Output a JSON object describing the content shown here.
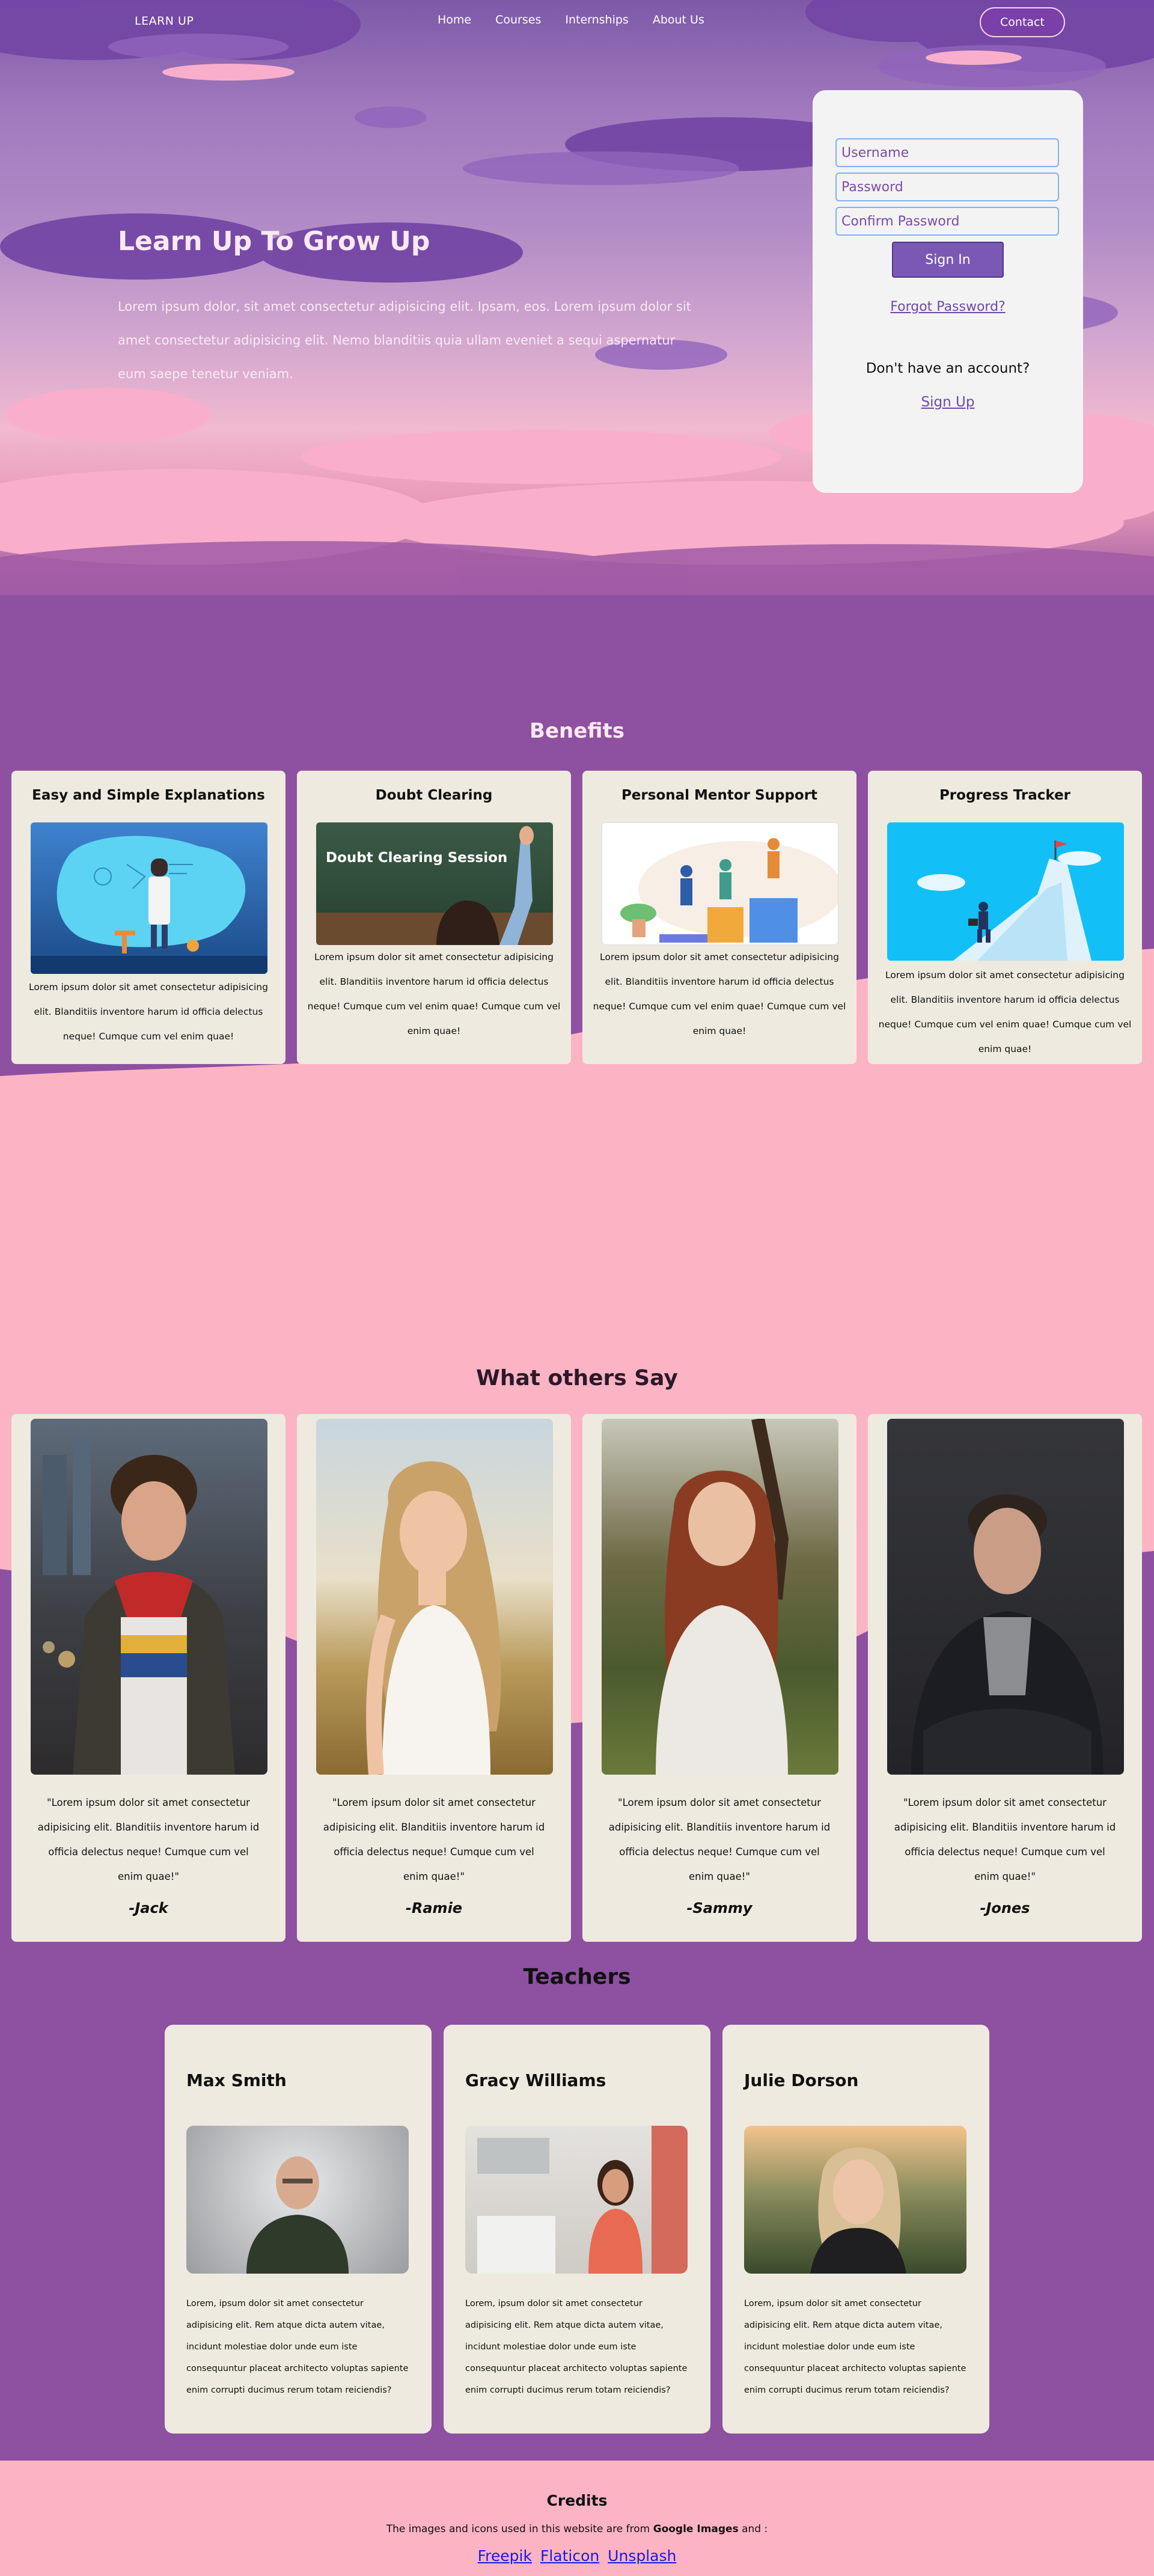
{
  "nav": {
    "brand": "LEARN UP",
    "links": [
      "Home",
      "Courses",
      "Internships",
      "About Us"
    ],
    "contact": "Contact"
  },
  "hero": {
    "title": "Learn Up To Grow Up",
    "text": "Lorem ipsum dolor, sit amet consectetur adipisicing elit. Ipsam, eos. Lorem ipsum dolor sit amet consectetur adipisicing elit. Nemo blanditiis quia ullam eveniet a sequi aspernatur eum saepe tenetur veniam."
  },
  "signin": {
    "username_placeholder": "Username",
    "password_placeholder": "Password",
    "confirm_placeholder": "Confirm Password",
    "button": "Sign In",
    "forgot": "Forgot Password?",
    "no_account": "Don't have an account?",
    "signup": "Sign Up"
  },
  "benefits": {
    "title": "Benefits",
    "cards": [
      {
        "title": "Easy and Simple Explanations",
        "text": "Lorem ipsum dolor sit amet consectetur adipisicing elit. Blanditiis inventore harum id officia delectus neque! Cumque cum vel enim quae!"
      },
      {
        "title": "Doubt Clearing",
        "image_caption": "Doubt Clearing Session",
        "text": "Lorem ipsum dolor sit amet consectetur adipisicing elit. Blanditiis inventore harum id officia delectus neque! Cumque cum vel enim quae! Cumque cum vel enim quae!"
      },
      {
        "title": "Personal Mentor Support",
        "text": "Lorem ipsum dolor sit amet consectetur adipisicing elit. Blanditiis inventore harum id officia delectus neque! Cumque cum vel enim quae! Cumque cum vel enim quae!"
      },
      {
        "title": "Progress Tracker",
        "text": "Lorem ipsum dolor sit amet consectetur adipisicing elit. Blanditiis inventore harum id officia delectus neque! Cumque cum vel enim quae! Cumque cum vel enim quae!"
      }
    ]
  },
  "testimonials": {
    "title": "What others Say",
    "items": [
      {
        "quote": "\"Lorem ipsum dolor sit amet consectetur adipisicing elit. Blanditiis inventore harum id officia delectus neque! Cumque cum vel enim quae!\"",
        "name": "-Jack"
      },
      {
        "quote": "\"Lorem ipsum dolor sit amet consectetur adipisicing elit. Blanditiis inventore harum id officia delectus neque! Cumque cum vel enim quae!\"",
        "name": "-Ramie"
      },
      {
        "quote": "\"Lorem ipsum dolor sit amet consectetur adipisicing elit. Blanditiis inventore harum id officia delectus neque! Cumque cum vel enim quae!\"",
        "name": "-Sammy"
      },
      {
        "quote": "\"Lorem ipsum dolor sit amet consectetur adipisicing elit. Blanditiis inventore harum id officia delectus neque! Cumque cum vel enim quae!\"",
        "name": "-Jones"
      }
    ]
  },
  "teachers": {
    "title": "Teachers",
    "items": [
      {
        "name": "Max Smith",
        "text": "Lorem, ipsum dolor sit amet consectetur adipisicing elit. Rem atque dicta autem vitae, incidunt molestiae dolor unde eum iste consequuntur placeat architecto voluptas sapiente enim corrupti ducimus rerum totam reiciendis?"
      },
      {
        "name": "Gracy Williams",
        "text": "Lorem, ipsum dolor sit amet consectetur adipisicing elit. Rem atque dicta autem vitae, incidunt molestiae dolor unde eum iste consequuntur placeat architecto voluptas sapiente enim corrupti ducimus rerum totam reiciendis?"
      },
      {
        "name": "Julie Dorson",
        "text": "Lorem, ipsum dolor sit amet consectetur adipisicing elit. Rem atque dicta autem vitae, incidunt molestiae dolor unde eum iste consequuntur placeat architecto voluptas sapiente enim corrupti ducimus rerum totam reiciendis?"
      }
    ]
  },
  "credits": {
    "title": "Credits",
    "line_start": "The images and icons used in this website are from ",
    "line_bold": "Google Images",
    "line_end": " and :",
    "links": [
      "Freepik",
      "Flaticon",
      "Unsplash"
    ]
  }
}
